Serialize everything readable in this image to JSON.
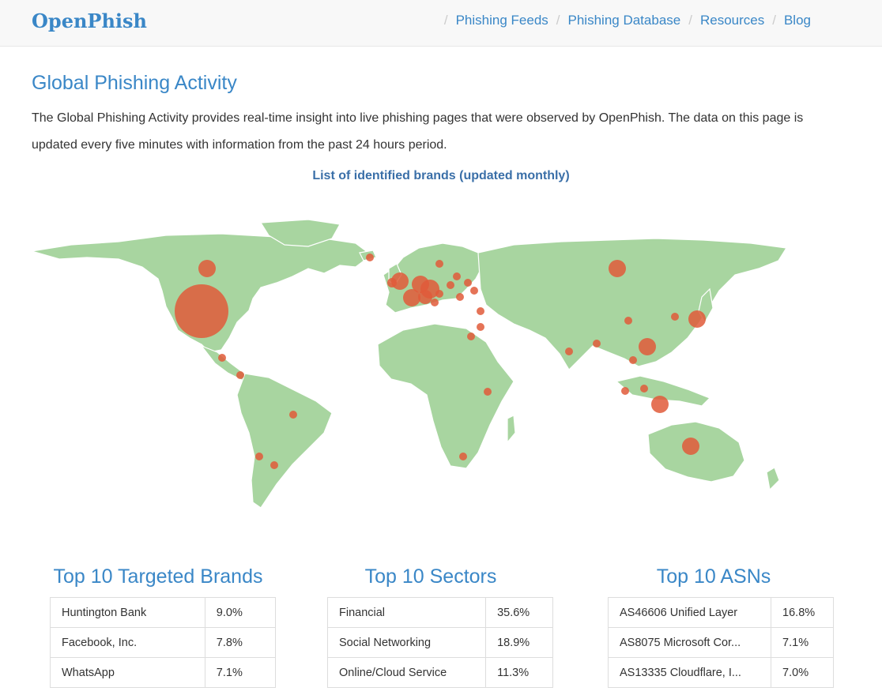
{
  "header": {
    "logo": "OpenPhish",
    "nav": [
      {
        "label": "Phishing Feeds"
      },
      {
        "label": "Phishing Database"
      },
      {
        "label": "Resources"
      },
      {
        "label": "Blog"
      }
    ],
    "separator": "/"
  },
  "main": {
    "title": "Global Phishing Activity",
    "intro": "The Global Phishing Activity provides real-time insight into live phishing pages that were observed by OpenPhish. The data on this page is updated every five minutes with information from the past 24 hours period.",
    "brands_link": "List of identified brands (updated monthly)"
  },
  "colors": {
    "accent": "#3a87c7",
    "land": "#a8d5a0",
    "bubble": "#e05a3a"
  },
  "sections": {
    "brands": {
      "title": "Top 10 Targeted Brands",
      "rows": [
        {
          "name": "Huntington Bank",
          "value": "9.0%"
        },
        {
          "name": "Facebook, Inc.",
          "value": "7.8%"
        },
        {
          "name": "WhatsApp",
          "value": "7.1%"
        }
      ]
    },
    "sectors": {
      "title": "Top 10 Sectors",
      "rows": [
        {
          "name": "Financial",
          "value": "35.6%"
        },
        {
          "name": "Social Networking",
          "value": "18.9%"
        },
        {
          "name": "Online/Cloud Service",
          "value": "11.3%"
        }
      ]
    },
    "asns": {
      "title": "Top 10 ASNs",
      "rows": [
        {
          "name": "AS46606 Unified Layer",
          "value": "16.8%"
        },
        {
          "name": "AS8075 Microsoft Cor...",
          "value": "7.1%"
        },
        {
          "name": "AS13335 Cloudflare, I...",
          "value": "7.0%"
        }
      ]
    }
  }
}
